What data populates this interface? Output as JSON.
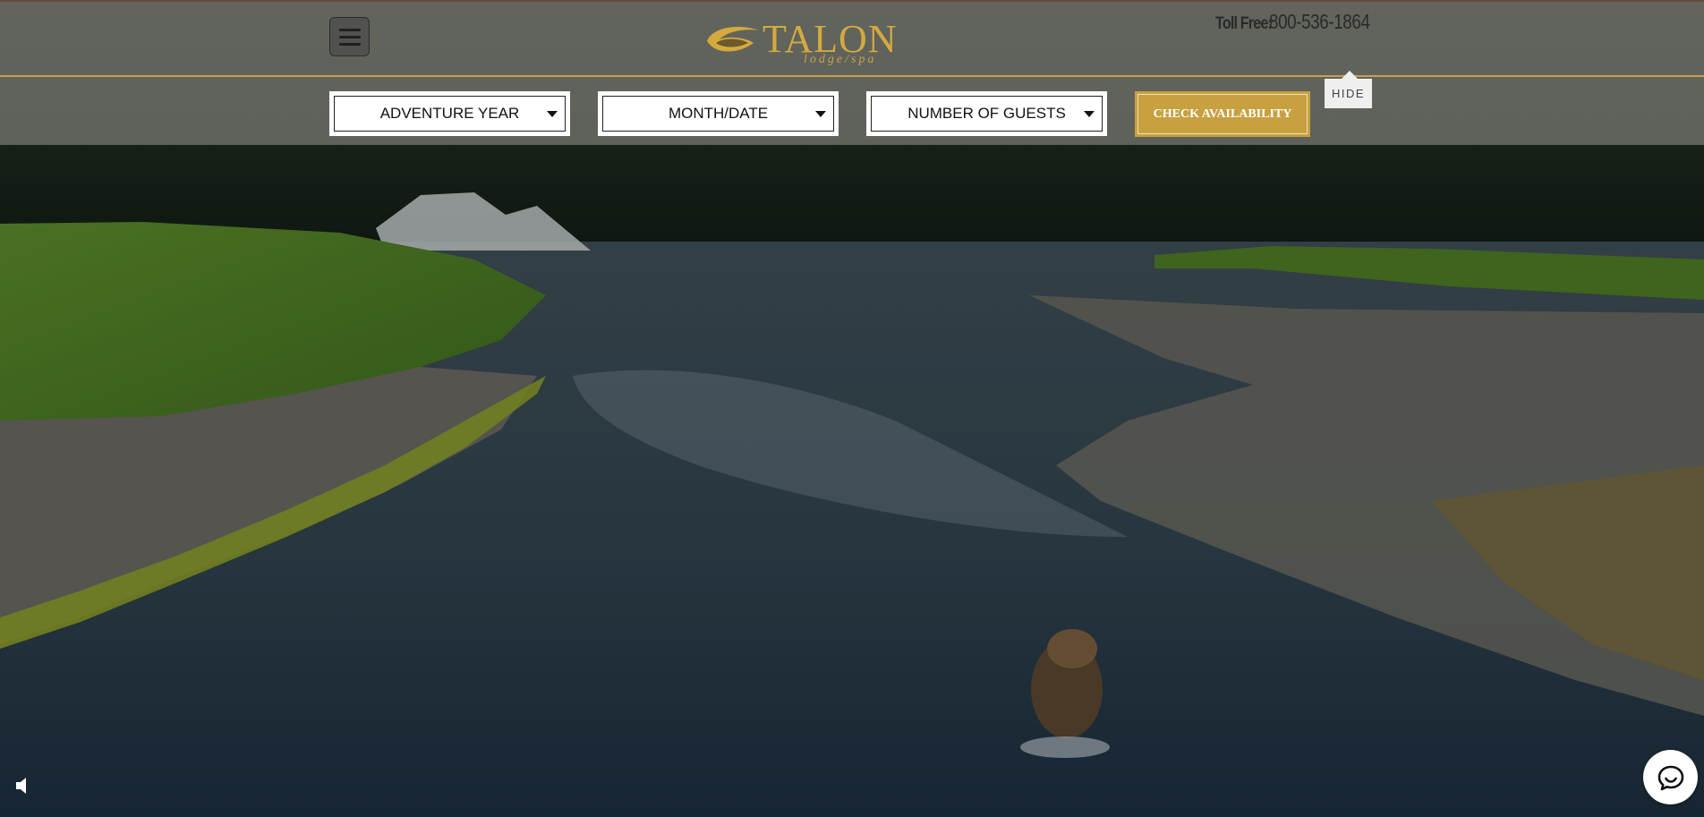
{
  "header": {
    "logo": {
      "brand": "TALON",
      "tagline": "lodge/spa"
    },
    "phone": {
      "label": "Toll Free:",
      "number": "800-536-1864"
    },
    "menu_icon": "hamburger-menu-icon"
  },
  "booking_bar": {
    "year_select": "ADVENTURE YEAR",
    "date_select": "MONTH/DATE",
    "guests_select": "NUMBER OF GUESTS",
    "submit_label": "CHECK AVAILABILITY",
    "hide_label": "HIDE"
  },
  "hero": {
    "sound_icon": "speaker-icon",
    "chat_icon": "chat-bubble-icon"
  },
  "colors": {
    "gold": "#c7a040",
    "header_overlay": "#73736e"
  }
}
